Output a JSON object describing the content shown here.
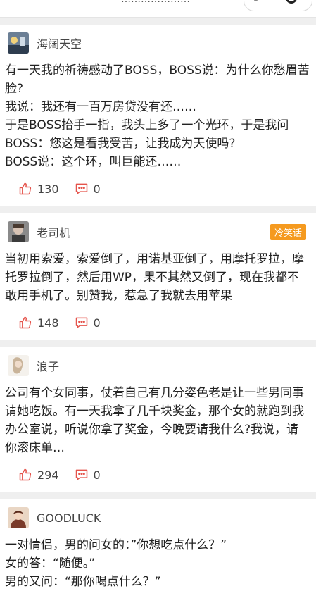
{
  "header": {
    "title_fragment": "…………………"
  },
  "posts": [
    {
      "author": "海阔天空",
      "tag": "",
      "lines": [
        "有一天我的祈祷感动了BOSS，BOSS说：为什么你愁眉苦脸?",
        "我说：我还有一百万房贷没有还……",
        "于是BOSS抬手一指，我头上多了一个光环，于是我问BOSS：您这是看我受苦，让我成为天使吗?",
        "BOSS说：这个环，叫巨能还……"
      ],
      "likes": "130",
      "comments": "0"
    },
    {
      "author": "老司机",
      "tag": "冷笑话",
      "lines": [
        "当初用索爱，索爱倒了，用诺基亚倒了，用摩托罗拉，摩托罗拉倒了，然后用WP，果不其然又倒了，现在我都不敢用手机了。别赞我，惹急了我就去用苹果"
      ],
      "likes": "148",
      "comments": "0"
    },
    {
      "author": "浪子",
      "tag": "",
      "lines": [
        "公司有个女同事，仗着自己有几分姿色老是让一些男同事请她吃饭。有一天我拿了几千块奖金，那个女的就跑到我办公室说，听说你拿了奖金，今晚要请我什么?我说，请你滚床单…"
      ],
      "likes": "294",
      "comments": "0"
    },
    {
      "author": "GOODLUCK",
      "tag": "",
      "lines": [
        "一对情侣，男的问女的：”你想吃点什么？”",
        "女的答：“随便。”",
        "男的又问：“那你喝点什么？”"
      ],
      "likes": "",
      "comments": ""
    }
  ],
  "colors": {
    "accent_tag": "#f59a1f",
    "icon_red": "#e5534b"
  },
  "icons": {
    "like": "thumbs-up-icon",
    "comment": "comment-icon"
  }
}
